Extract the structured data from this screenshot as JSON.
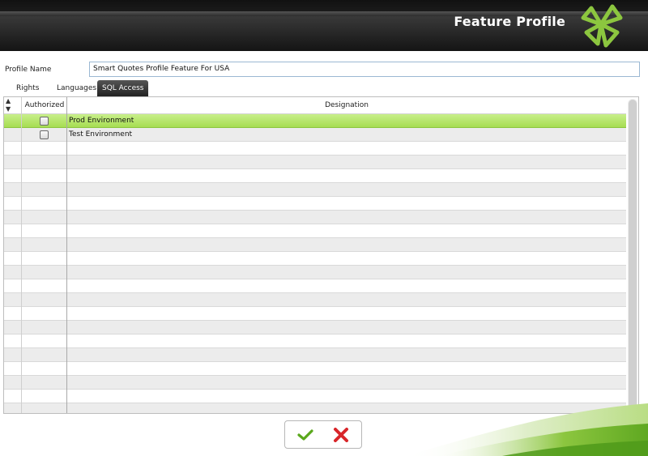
{
  "header": {
    "title": "Feature Profile",
    "logo_icon": "clover-logo-icon",
    "colors": {
      "accent": "#8cc63f",
      "dark": "#1a1a1a"
    }
  },
  "profile": {
    "label": "Profile Name",
    "value": "Smart Quotes Profile Feature For USA"
  },
  "tabs": [
    {
      "label": "Rights",
      "active": false
    },
    {
      "label": "Languages",
      "active": false
    },
    {
      "label": "SQL Access",
      "active": true
    }
  ],
  "grid": {
    "columns": {
      "selector_icon": "sort-arrows-icon",
      "authorized": "Authorized",
      "designation": "Designation"
    },
    "rows": [
      {
        "authorized": false,
        "designation": "Prod Environment",
        "selected": true
      },
      {
        "authorized": false,
        "designation": "Test Environment",
        "selected": false
      }
    ],
    "empty_rows": 20
  },
  "actions": {
    "ok_icon": "checkmark-icon",
    "cancel_icon": "cross-icon"
  }
}
